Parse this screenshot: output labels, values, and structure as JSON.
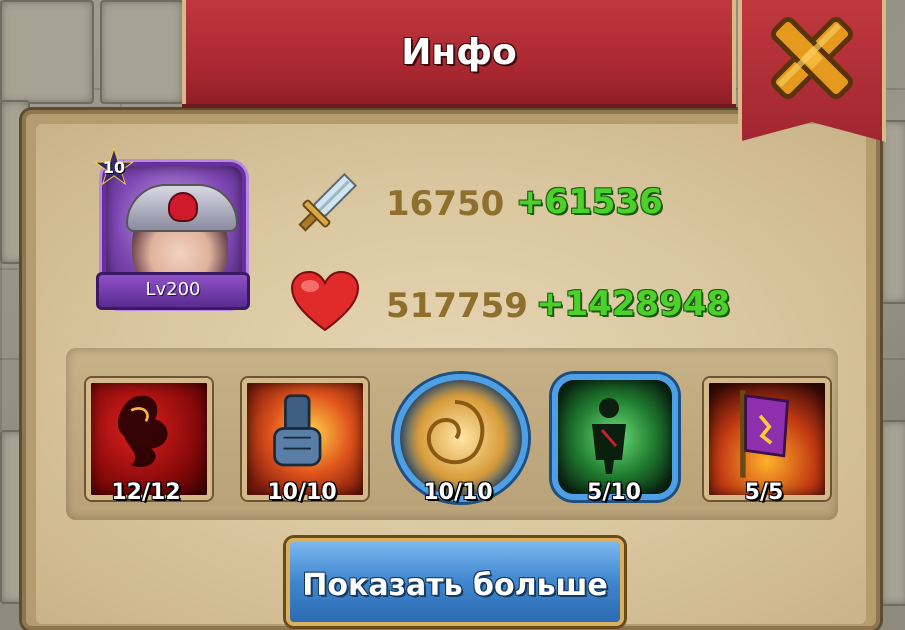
{
  "window": {
    "title": "Инфо"
  },
  "hero": {
    "stars": "10",
    "level": "Lv200"
  },
  "stats": {
    "attack": {
      "icon": "sword-icon",
      "base": "16750",
      "bonus": "+61536"
    },
    "health": {
      "icon": "heart-icon",
      "base": "517759",
      "bonus": "+1428948"
    }
  },
  "skills": [
    {
      "icon": "flame-figure-icon",
      "level": "12/12"
    },
    {
      "icon": "armored-fist-icon",
      "level": "10/10"
    },
    {
      "icon": "golden-shell-icon",
      "level": "10/10"
    },
    {
      "icon": "green-silhouette-icon",
      "level": "5/10"
    },
    {
      "icon": "purple-banner-icon",
      "level": "5/5"
    }
  ],
  "actions": {
    "show_more": "Показать больше"
  },
  "colors": {
    "banner_red": "#b0303a",
    "parchment": "#dcc9a1",
    "bonus_green": "#4bd12a",
    "base_brown": "#8f6f2e",
    "button_blue": "#3f86cf"
  }
}
